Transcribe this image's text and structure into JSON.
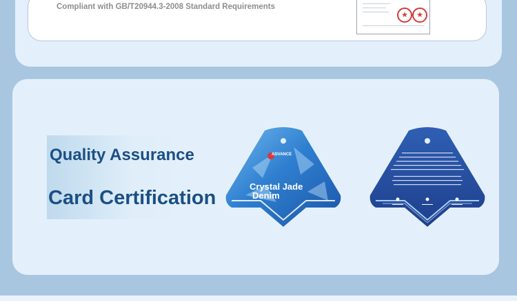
{
  "compliance": {
    "text": "Compliant with GB/T20944.3-2008 Standard Requirements"
  },
  "quality": {
    "heading": "Quality Assurance",
    "subheading": "Card Certification"
  },
  "tag": {
    "brand": "ADVANCE",
    "title_line1": "Crystal Jade",
    "title_line2": "Denim"
  },
  "colors": {
    "background": "#a9c6e0",
    "panel": "#e3f0fb",
    "heading": "#1c4f84",
    "tag_front": "#2f7fd0",
    "tag_back": "#254a9c",
    "stamp": "#d43a3a"
  }
}
